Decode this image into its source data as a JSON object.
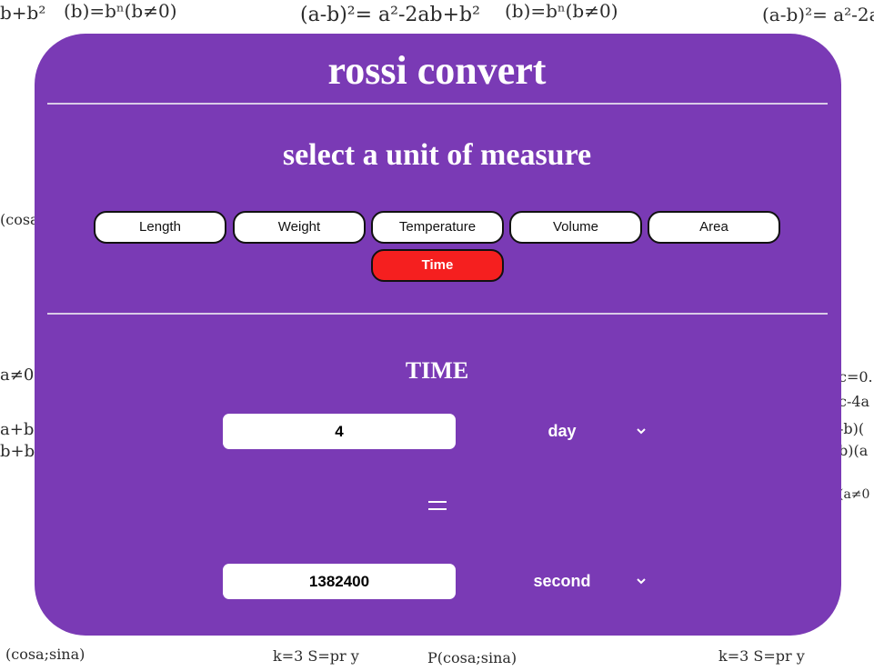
{
  "app": {
    "title": "rossi convert",
    "subtitle": "select a unit of measure"
  },
  "categories": [
    {
      "label": "Length",
      "active": false
    },
    {
      "label": "Weight",
      "active": false
    },
    {
      "label": "Temperature",
      "active": false
    },
    {
      "label": "Volume",
      "active": false
    },
    {
      "label": "Area",
      "active": false
    },
    {
      "label": "Time",
      "active": true
    }
  ],
  "converter": {
    "section_title": "TIME",
    "input_value": "4",
    "input_unit": "day",
    "equals_sign": "=",
    "output_value": "1382400",
    "output_unit": "second"
  },
  "colors": {
    "panel": "#7a3ab5",
    "active_button": "#f51f1f",
    "button": "#ffffff",
    "text": "#ffffff"
  },
  "icons": {
    "select_arrow": "chevron-down-icon",
    "equals": "equals-icon"
  }
}
